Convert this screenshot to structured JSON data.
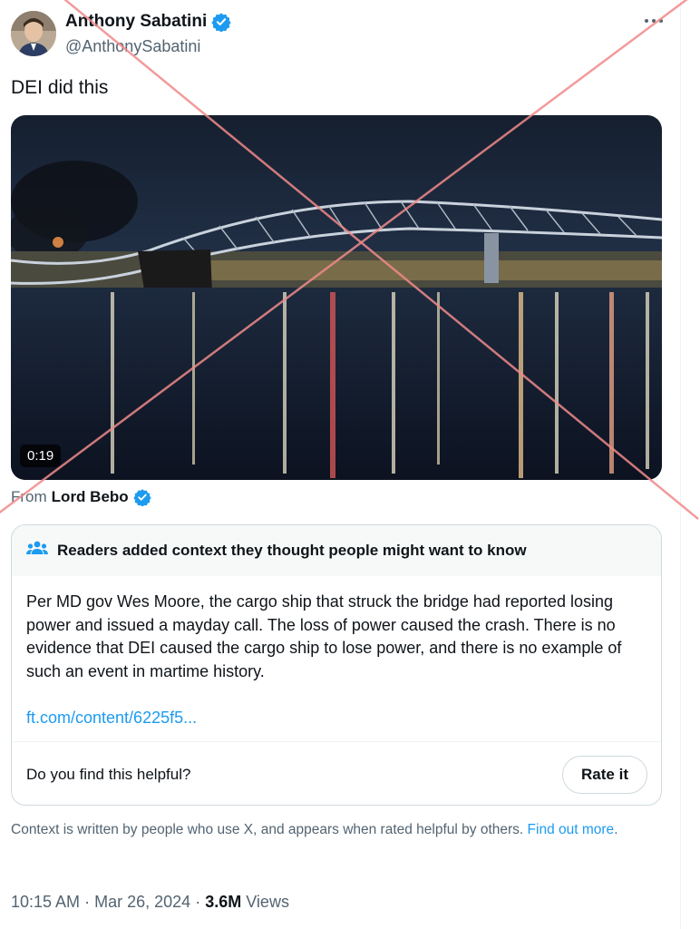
{
  "author": {
    "display_name": "Anthony Sabatini",
    "handle": "@AnthonySabatini",
    "verified_icon": "verified-badge-icon"
  },
  "tweet": {
    "text": "DEI did this"
  },
  "media": {
    "duration": "0:19",
    "from_label": "From",
    "from_user": "Lord Bebo"
  },
  "community_note": {
    "header": "Readers added context they thought people might want to know",
    "header_icon": "people-icon",
    "body": "Per MD gov Wes Moore, the cargo ship that struck the bridge had reported losing power and issued a mayday call. The loss of power caused the crash. There is no evidence that DEI caused the cargo ship to lose power, and there is no example of such an event in martime history.",
    "link": "ft.com/content/6225f5...",
    "helpful_question": "Do you find this helpful?",
    "rate_button": "Rate it"
  },
  "context_footer": {
    "text": "Context is written by people who use X, and appears when rated helpful by others.",
    "link": "Find out more",
    "trailing": "."
  },
  "meta": {
    "time": "10:15 AM",
    "sep1": "·",
    "date": "Mar 26, 2024",
    "sep2": "·",
    "views_count": "3.6M",
    "views_label": "Views"
  },
  "colors": {
    "accent_blue": "#1d9bf0",
    "secondary_text": "#536471",
    "overlay_x": "#f08a8a"
  }
}
